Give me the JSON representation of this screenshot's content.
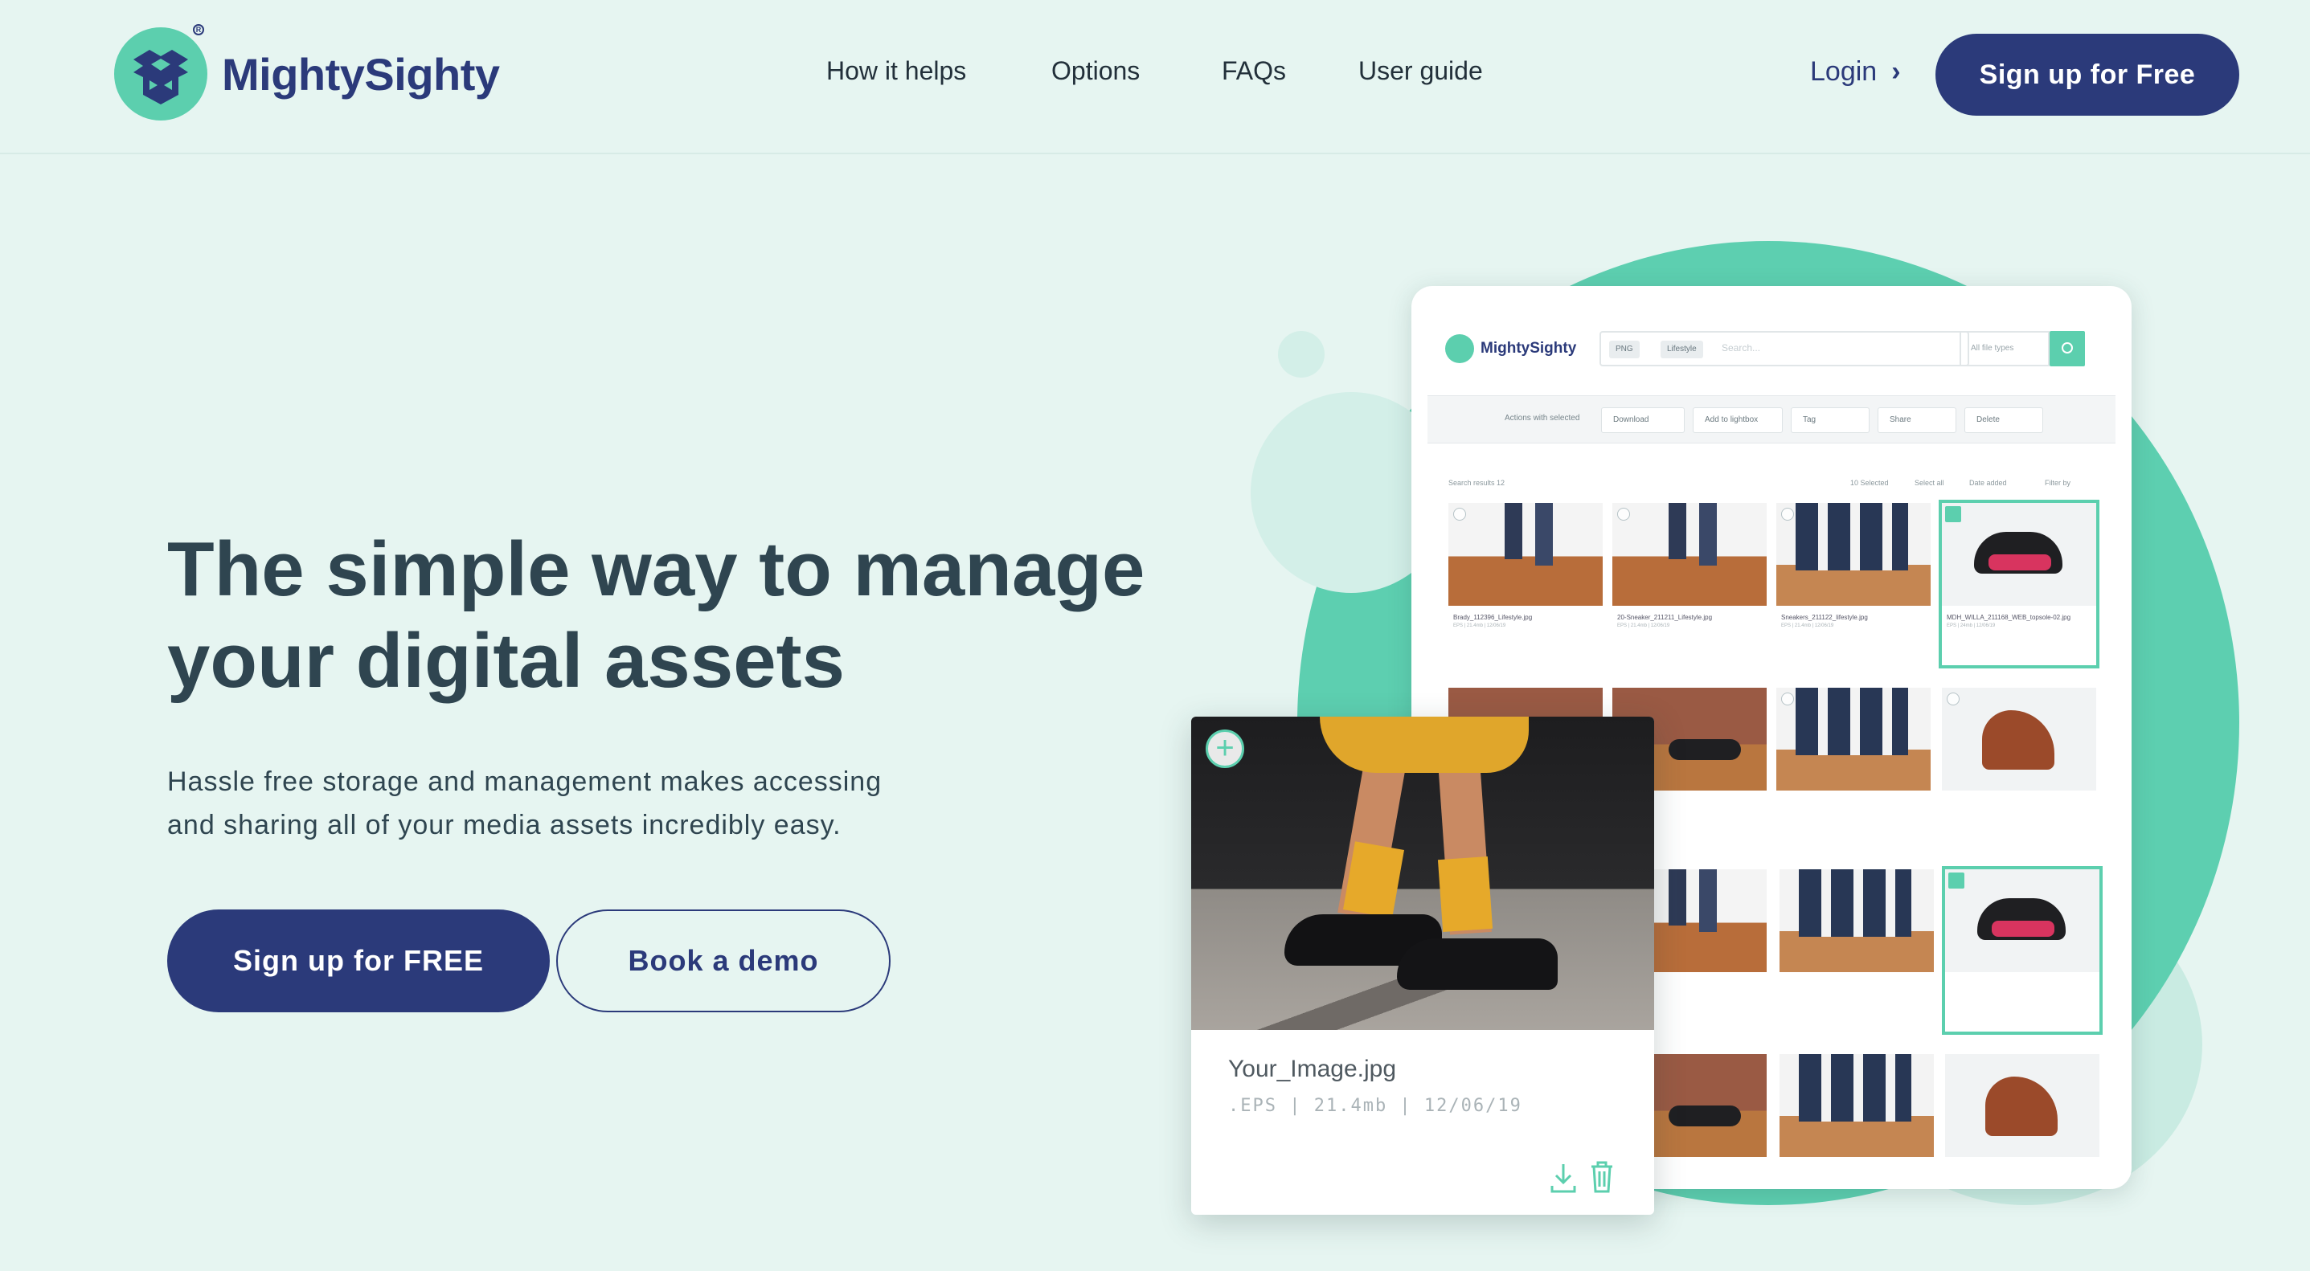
{
  "brand": {
    "name": "MightySighty",
    "accent": "#5ccfae",
    "primary": "#2b3a7a",
    "background": "#e6f5f1"
  },
  "nav": [
    "How it helps",
    "Options",
    "FAQs",
    "User guide"
  ],
  "header": {
    "login": "Login",
    "signup": "Sign up for Free"
  },
  "hero": {
    "title_line1": "The simple way to manage",
    "title_line2": "your digital assets",
    "subtitle_line1": "Hassle free storage and management makes accessing",
    "subtitle_line2": "and sharing all of your media assets incredibly easy.",
    "primary_cta": "Sign up for FREE",
    "secondary_cta": "Book a demo"
  },
  "mockup": {
    "logo": "MightySighty",
    "chips": [
      "PNG",
      "Lifestyle"
    ],
    "search_placeholder": "Search...",
    "types": "All file types",
    "toolbar_label": "Actions with selected",
    "toolbar": [
      "Download",
      "Add to lightbox",
      "Tag",
      "Share",
      "Delete"
    ],
    "results": "Search results 12",
    "sort": [
      "10 Selected",
      "Select all",
      "Date added",
      "Filter by"
    ],
    "thumbs": [
      {
        "name": "Brady_112396_Lifestyle.jpg",
        "meta": "EPS | 21.4mb | 12/06/19"
      },
      {
        "name": "20-Sneaker_211211_Lifestyle.jpg",
        "meta": "EPS | 21.4mb | 12/06/19"
      },
      {
        "name": "Sneakers_211122_lifestyle.jpg",
        "meta": "EPS | 21.4mb | 12/06/19"
      },
      {
        "name": "MDH_WILLA_211168_WEB_topsole-02.jpg",
        "meta": "EPS | 24mb | 12/06/19"
      }
    ],
    "card": {
      "name": "Your_Image.jpg",
      "meta": ".EPS  |  21.4mb  |  12/06/19"
    }
  }
}
